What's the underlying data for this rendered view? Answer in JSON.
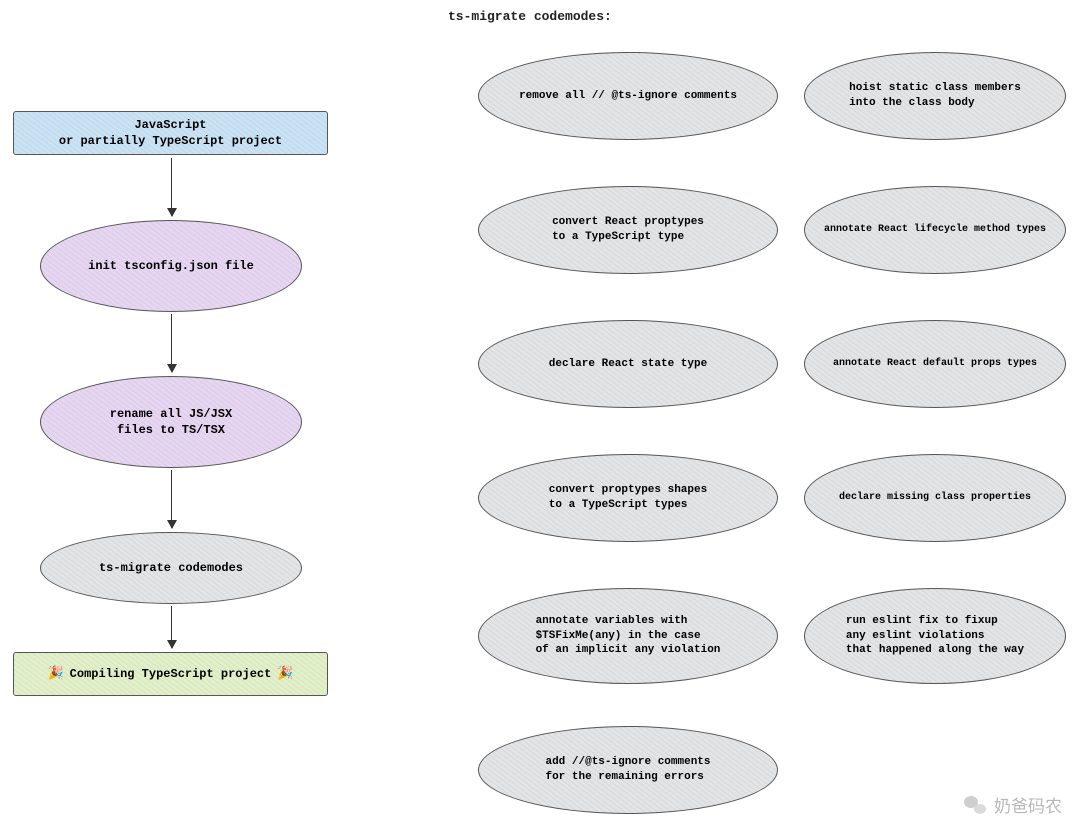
{
  "heading": "ts-migrate codemodes:",
  "flow": {
    "start": "JavaScript\nor partially TypeScript project",
    "step1": "init tsconfig.json file",
    "step2": "rename all JS/JSX\nfiles to TS/TSX",
    "step3": "ts-migrate codemodes",
    "end": "Compiling TypeScript project"
  },
  "codemods": {
    "left": [
      "remove all // @ts-ignore comments",
      "convert React proptypes\nto a TypeScript type",
      "declare React state type",
      "convert proptypes shapes\nto a TypeScript types",
      "annotate variables with\n$TSFixMe(any) in the case\nof an implicit any violation",
      "add //@ts-ignore comments\nfor the remaining errors"
    ],
    "right": [
      "hoist static class members\ninto the class body",
      "annotate React lifecycle method types",
      "annotate React default props types",
      "declare missing class properties",
      "run eslint fix to fixup\nany eslint violations\nthat happened along the way"
    ]
  },
  "watermark": "奶爸码农",
  "emoji": "🎉"
}
